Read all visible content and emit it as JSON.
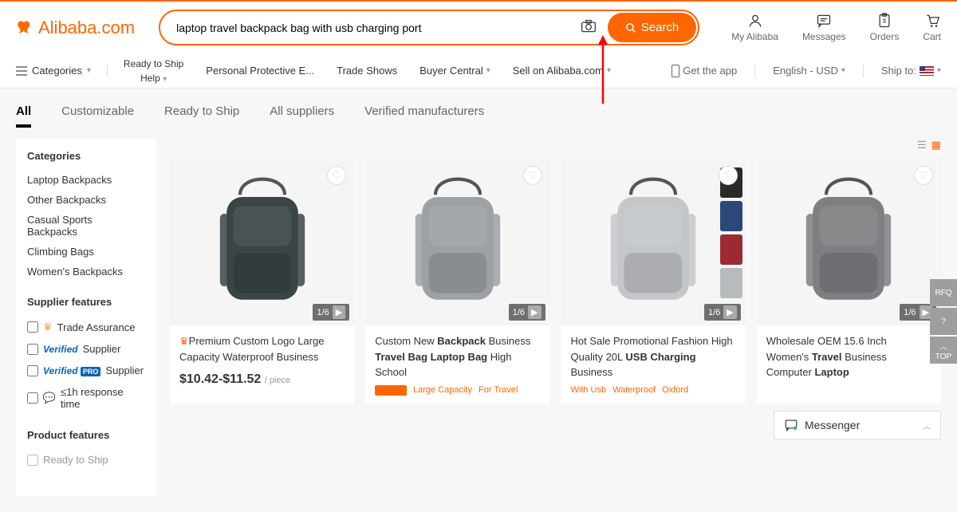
{
  "header": {
    "logo_text": "Alibaba.com",
    "search_value": "laptop travel backpack bag with usb charging port",
    "search_button": "Search",
    "top_icons": [
      {
        "label": "My Alibaba",
        "icon": "user"
      },
      {
        "label": "Messages",
        "icon": "chat"
      },
      {
        "label": "Orders",
        "icon": "clipboard"
      },
      {
        "label": "Cart",
        "icon": "cart"
      }
    ]
  },
  "nav": {
    "categories_label": "Categories",
    "left_links": {
      "stack": [
        "Ready to Ship",
        "Help"
      ],
      "items": [
        "Personal Protective E...",
        "Trade Shows",
        "Buyer Central",
        "Sell on Alibaba.com"
      ]
    },
    "right": {
      "get_app": "Get the app",
      "lang_currency": "English - USD",
      "ship_to": "Ship to:"
    }
  },
  "tabs": [
    "All",
    "Customizable",
    "Ready to Ship",
    "All suppliers",
    "Verified manufacturers"
  ],
  "sidebar": {
    "categories_title": "Categories",
    "categories": [
      "Laptop Backpacks",
      "Other Backpacks",
      "Casual Sports Backpacks",
      "Climbing Bags",
      "Women's Backpacks"
    ],
    "supplier_features_title": "Supplier features",
    "supplier_features": [
      {
        "type": "trade",
        "label": "Trade Assurance"
      },
      {
        "type": "verified",
        "label": "Supplier"
      },
      {
        "type": "verified_pro",
        "label": "Supplier"
      },
      {
        "type": "response",
        "label": "≤1h response time"
      }
    ],
    "product_features_title": "Product features",
    "product_features": [
      "Ready to Ship"
    ]
  },
  "products": [
    {
      "counter": "1/6",
      "crown": true,
      "title_plain": "Premium Custom Logo Large Capacity Waterproof Business",
      "tags": [],
      "price": "$10.42-$11.52",
      "price_unit": "/ piece",
      "bg": "#3a4548"
    },
    {
      "counter": "1/6",
      "title_html": "Custom New <b>Backpack</b> Business <b>Travel Bag Laptop Bag</b> High School",
      "tags": [
        "Large Capacity",
        "For Travel"
      ],
      "tag_new": true,
      "bg": "#9ca1a6"
    },
    {
      "counter": "1/6",
      "title_html": "Hot Sale Promotional Fashion High Quality 20L <b>USB Charging</b> Business",
      "tags": [
        "With Usb",
        "Waterproof",
        "Oxford"
      ],
      "bg": "#c4c7ca",
      "swatches": [
        "#2a2a2a",
        "#2b4878",
        "#9c2a33",
        "#b8bbbd"
      ]
    },
    {
      "counter": "1/6",
      "title_html": "Wholesale OEM 15.6 Inch Women's <b>Travel</b> Business Computer <b>Laptop</b>",
      "tags": [],
      "bg": "#7d7f82"
    }
  ],
  "messenger": "Messenger",
  "rail": {
    "top": "TOP",
    "rfq": "RFQ"
  }
}
